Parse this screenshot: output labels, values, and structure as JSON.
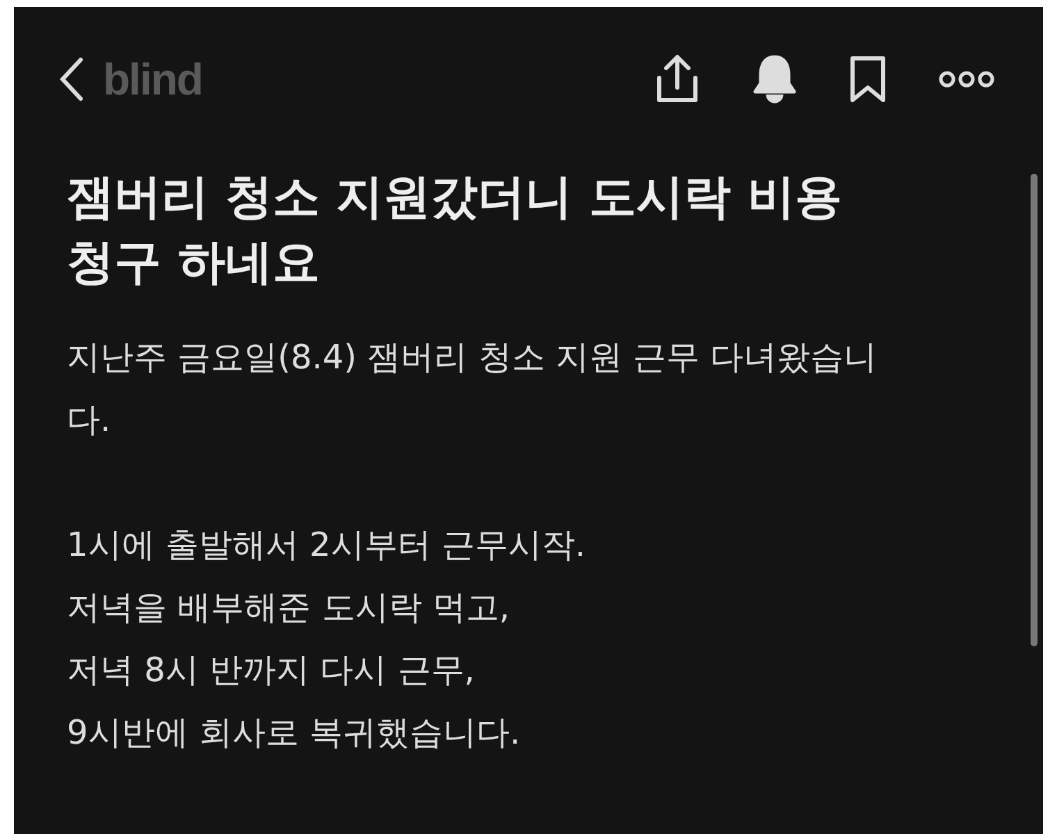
{
  "header": {
    "logo": "blind",
    "notifications_on": true,
    "bookmarked": false
  },
  "post": {
    "title": "잼버리 청소 지원갔더니 도시락 비용 청구 하네요",
    "paragraphs": [
      [
        "지난주 금요일(8.4) 잼버리 청소 지원 근무 다녀왔습니",
        "다."
      ],
      [
        "1시에 출발해서 2시부터 근무시작.",
        "저녁을 배부해준 도시락 먹고,",
        "저녁 8시 반까지 다시 근무,",
        "9시반에 회사로 복귀했습니다."
      ]
    ]
  }
}
